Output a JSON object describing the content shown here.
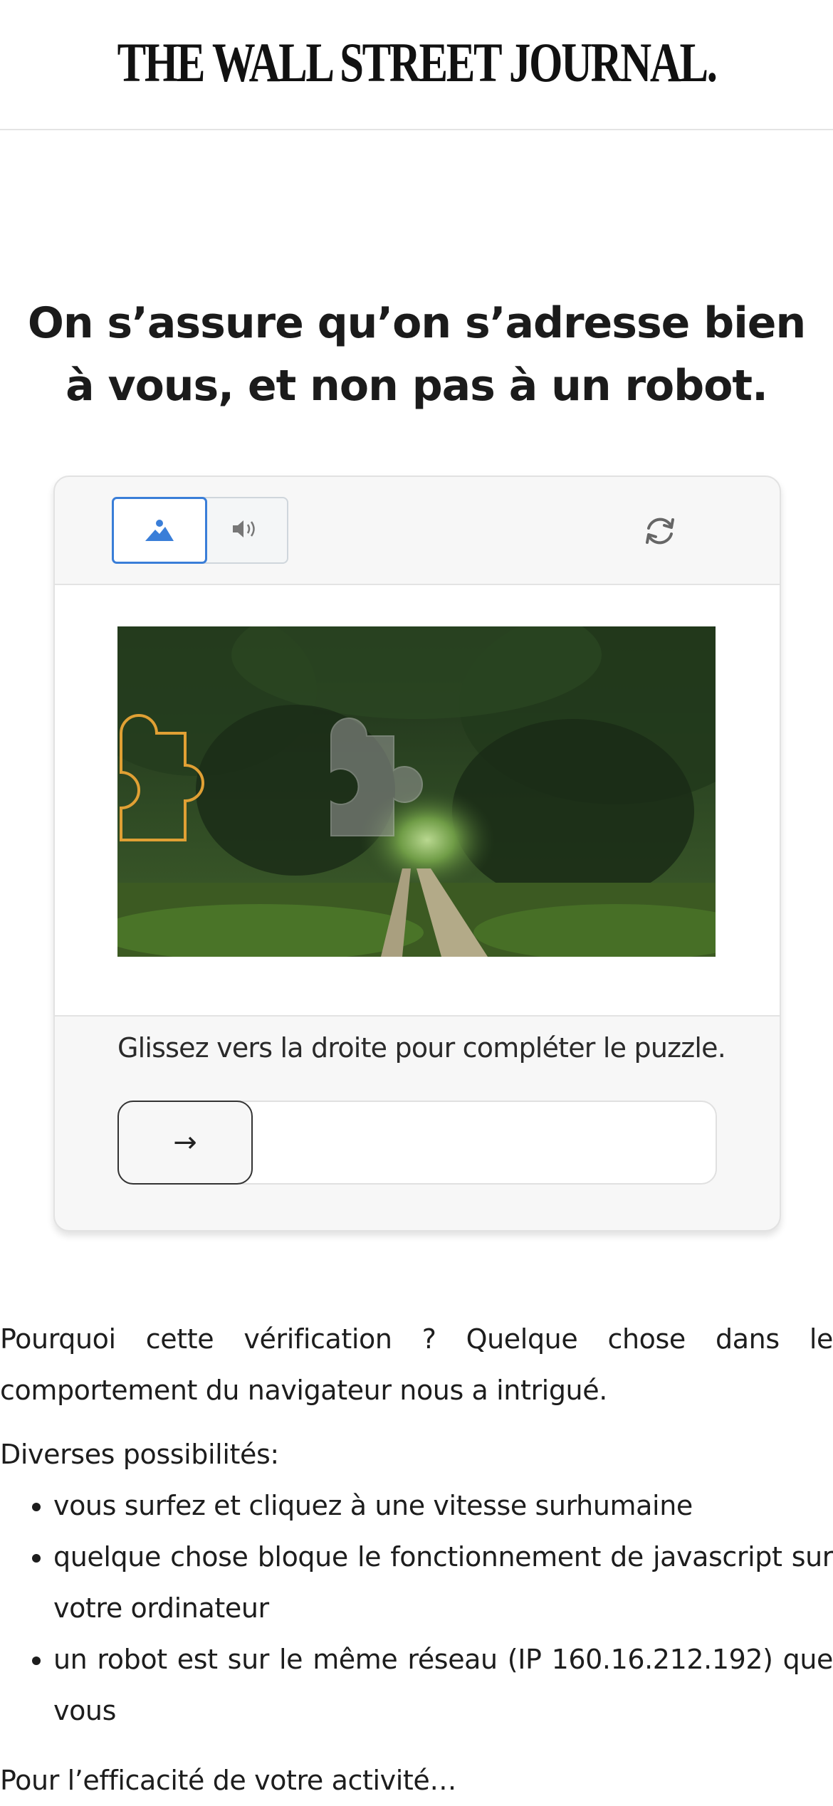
{
  "header": {
    "logo_text": "THE WALL STREET JOURNAL."
  },
  "headline": "On s’assure qu’on s’adresse bien à vous, et non pas à un robot.",
  "captcha": {
    "modes": [
      {
        "icon": "image-icon",
        "selected": true
      },
      {
        "icon": "audio-icon",
        "selected": false
      }
    ],
    "refresh_icon": "refresh-icon",
    "instruction": "Glissez vers la droite pour compléter le puzzle.",
    "slider_arrow": "→",
    "slider_progress": 0,
    "accent_color": "#3a7ed8",
    "piece_outline_color": "#e0a034"
  },
  "explanation": {
    "paragraph": "Pourquoi cette vérification ? Quelque chose dans le comportement du navigateur nous a intrigué.",
    "possibilities_label": "Diverses possibilités:",
    "reasons": [
      "vous surfez et cliquez à une vitesse surhumaine",
      "quelque chose bloque le fonctionnement de javascript sur votre ordinateur",
      "un robot est sur le même réseau (IP 160.16.212.192) que vous"
    ],
    "next_paragraph_partial": "Pour l’efficacité de votre activité…"
  }
}
